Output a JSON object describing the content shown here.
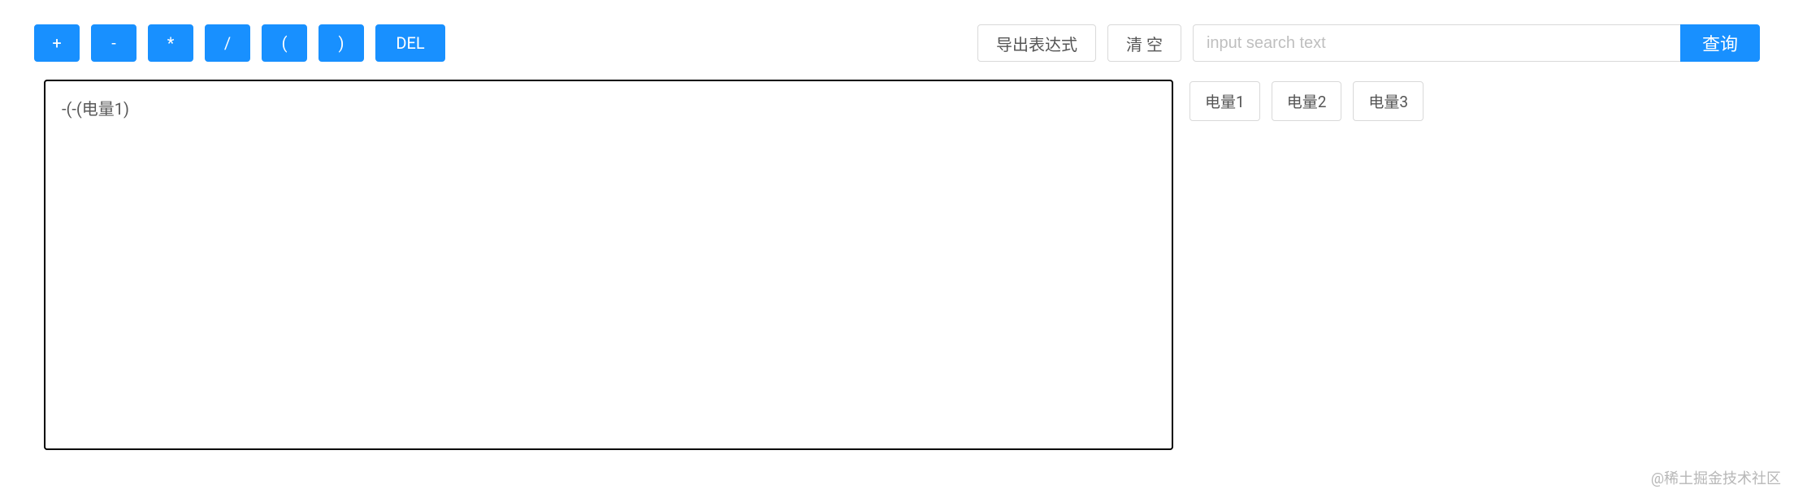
{
  "toolbar": {
    "ops": {
      "plus": "+",
      "minus": "-",
      "times": "*",
      "divide": "/",
      "lparen": "(",
      "rparen": ")",
      "del": "DEL"
    },
    "export_label": "导出表达式",
    "clear_label": "清 空"
  },
  "search": {
    "placeholder": "input search text",
    "value": "",
    "button_label": "查询"
  },
  "expression": {
    "text": "-(-(电量1)"
  },
  "tags": {
    "items": [
      "电量1",
      "电量2",
      "电量3"
    ]
  },
  "watermark": "@稀土掘金技术社区"
}
